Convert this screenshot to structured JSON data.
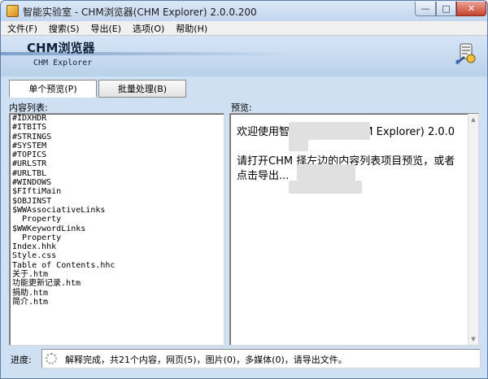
{
  "window": {
    "title": "智能实验室 - CHM浏览器(CHM Explorer) 2.0.0.200",
    "controls": {
      "minimize": "—",
      "maximize": "□",
      "close": "✕"
    }
  },
  "menu": {
    "items": [
      "文件(F)",
      "搜索(S)",
      "导出(E)",
      "选项(O)",
      "帮助(H)"
    ]
  },
  "banner": {
    "title": "CHM浏览器",
    "subtitle": "CHM Explorer",
    "icon": "tool-wizard-icon"
  },
  "tabs": [
    {
      "label": "单个预览(P)",
      "active": true
    },
    {
      "label": "批量处理(B)",
      "active": false
    }
  ],
  "content_list": {
    "label": "内容列表:",
    "items": [
      "#IDXHDR",
      "#ITBITS",
      "#STRINGS",
      "#SYSTEM",
      "#TOPICS",
      "#URLSTR",
      "#URLTBL",
      "#WINDOWS",
      "$FIftiMain",
      "$OBJINST",
      "$WWAssociativeLinks",
      "  Property",
      "$WWKeywordLinks",
      "  Property",
      "Index.hhk",
      "Style.css",
      "Table of Contents.hhc",
      "关于.htm",
      "功能更新记录.htm",
      "捐助.htm",
      "简介.htm"
    ]
  },
  "preview": {
    "label": "预览:",
    "paragraph1": "欢迎使用智能  M浏览器(CHM Explorer) 2.0.0",
    "paragraph2": "请打开CHM  择左边的内容列表项目预览，或者点击导出..."
  },
  "status": {
    "label": "进度:",
    "text": "解释完成，共21个内容，网页(5)，图片(0)，多媒体(0)，请导出文件。"
  },
  "colors": {
    "titlebar": "#c3d6ee",
    "banner": "#b9d0ea",
    "close_button": "#c7432e"
  }
}
